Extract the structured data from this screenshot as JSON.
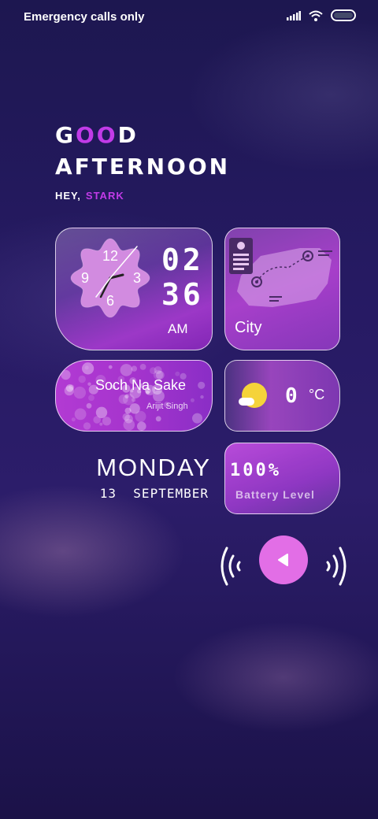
{
  "status_bar": {
    "text": "Emergency calls only",
    "icons": [
      "signal-icon",
      "wifi-icon",
      "battery-icon"
    ]
  },
  "greeting": {
    "line1": "GOOD",
    "line2": "AFTERNOON",
    "hey": "HEY,",
    "name": "STARK"
  },
  "clock": {
    "analog_numbers": [
      "12",
      "3",
      "6",
      "9"
    ],
    "hour": "02",
    "minute": "36",
    "ampm": "AM"
  },
  "map": {
    "city": "City"
  },
  "music": {
    "song": "Soch Na Sake",
    "artist": "Arijit Singh"
  },
  "weather": {
    "temp": "0",
    "unit": "°C",
    "icon": "partly-cloudy-icon"
  },
  "battery": {
    "percent": "100%",
    "label": "Battery Level"
  },
  "date": {
    "day": "MONDAY",
    "date": "13  SEPTEMBER"
  },
  "controls": {
    "play_icon": "play-icon"
  },
  "colors": {
    "accent": "#c23be8",
    "play": "#e26ee6",
    "sun": "#f5d33a"
  }
}
